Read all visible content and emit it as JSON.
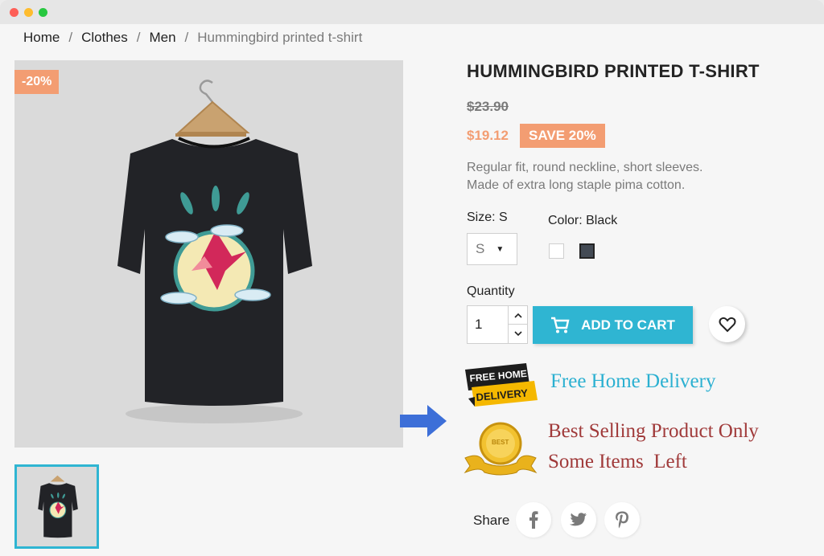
{
  "window": {
    "controls": [
      "close",
      "minimize",
      "maximize"
    ]
  },
  "breadcrumb": {
    "items": [
      "Home",
      "Clothes",
      "Men"
    ],
    "separator": "/",
    "current": "Hummingbird printed t-shirt"
  },
  "product": {
    "discount_flag": "-20%",
    "title": "HUMMINGBIRD PRINTED T-SHIRT",
    "old_price": "$23.90",
    "price": "$19.12",
    "save_badge": "SAVE 20%",
    "description_line1": "Regular fit, round neckline, short sleeves.",
    "description_line2": "Made of extra long staple pima  cotton.",
    "size_label": "Size: S",
    "size_selected": "S",
    "color_label": "Color: Black",
    "colors": [
      {
        "name": "White",
        "hex": "#ffffff"
      },
      {
        "name": "Black",
        "hex": "#434a54"
      }
    ],
    "quantity_label": "Quantity",
    "quantity_value": "1",
    "add_to_cart": "ADD TO CART"
  },
  "promo": {
    "delivery_badge_line1": "FREE HOME",
    "delivery_badge_line2": "DELIVERY",
    "delivery_text": "Free Home Delivery",
    "medal_text": "BEST",
    "best_selling_text": "Best Selling Product Only",
    "items_left_text": "Some Items  Left"
  },
  "share": {
    "label": "Share",
    "networks": [
      "facebook-icon",
      "twitter-icon",
      "pinterest-icon"
    ]
  },
  "colors": {
    "accent": "#2fb5d2",
    "discount": "#f39d72",
    "promo_blue": "#2bb0d1",
    "promo_red": "#a03a3a",
    "arrow": "#3d6fd8"
  }
}
